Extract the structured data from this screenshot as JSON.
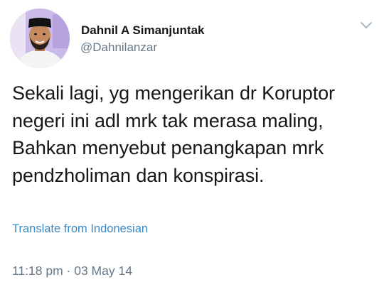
{
  "tweet": {
    "author": {
      "display_name": "Dahnil A Simanjuntak",
      "handle": "@Dahnilanzar"
    },
    "body_lines": [
      "Sekali lagi, yg mengerikan dr Koruptor",
      "negeri ini adl mrk tak merasa maling,",
      "Bahkan menyebut penangkapan mrk",
      "pendzholiman dan konspirasi."
    ],
    "translate_label": "Translate from Indonesian",
    "timestamp": "11:18 pm · 03 May 14",
    "menu_icon": "chevron-down-icon"
  },
  "colors": {
    "text_primary": "#14171a",
    "text_secondary": "#657786",
    "link": "#3b88c3",
    "background": "#ffffff"
  }
}
